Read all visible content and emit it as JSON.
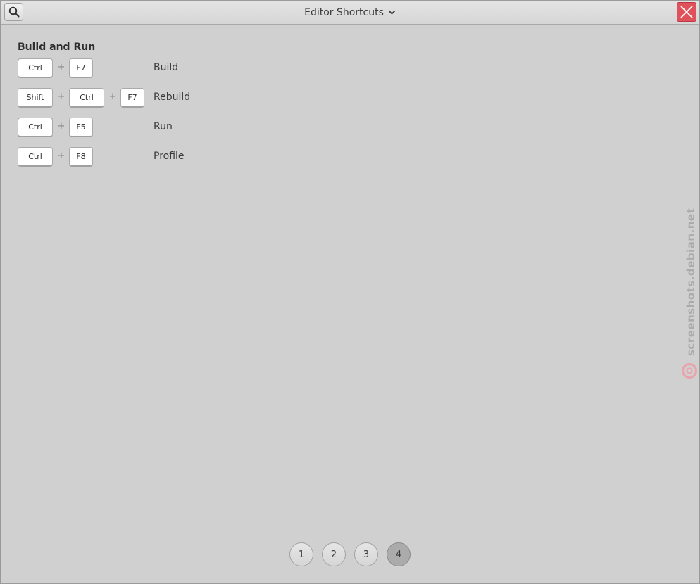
{
  "window": {
    "title": "Editor Shortcuts"
  },
  "icons": {
    "search": "search-icon",
    "dropdown": "chevron-down-icon",
    "close": "close-icon",
    "watermark_logo": "debian-swirl-icon"
  },
  "colors": {
    "close_button": "#e0525b",
    "watermark_logo": "#e8a5ad",
    "active_page": "#ababab"
  },
  "section": {
    "title": "Build and Run"
  },
  "shortcuts": [
    {
      "keys": [
        "Ctrl",
        "F7"
      ],
      "separator": "+",
      "action": "Build"
    },
    {
      "keys": [
        "Shift",
        "Ctrl",
        "F7"
      ],
      "separator": "+",
      "action": "Rebuild"
    },
    {
      "keys": [
        "Ctrl",
        "F5"
      ],
      "separator": "+",
      "action": "Run"
    },
    {
      "keys": [
        "Ctrl",
        "F8"
      ],
      "separator": "+",
      "action": "Profile"
    }
  ],
  "pager": {
    "pages": [
      "1",
      "2",
      "3",
      "4"
    ],
    "active": "4"
  },
  "watermark": {
    "text": "screenshots.debian.net"
  }
}
